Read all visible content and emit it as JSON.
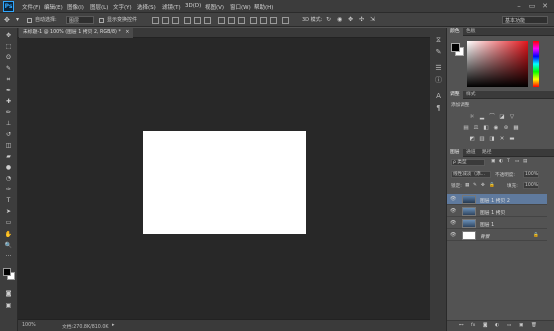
{
  "app": {
    "logo": "Ps"
  },
  "menubar": {
    "items": [
      "文件(F)",
      "编辑(E)",
      "图像(I)",
      "图层(L)",
      "文字(Y)",
      "选择(S)",
      "滤镜(T)",
      "3D(D)",
      "视图(V)",
      "窗口(W)",
      "帮助(H)"
    ],
    "window_controls": [
      "–",
      "▭",
      "✕"
    ]
  },
  "options": {
    "auto_select_label": "自动选择:",
    "auto_select_value": "图层",
    "show_transform_label": "显示变换控件",
    "mode_3d_label": "3D 模式:",
    "workspace_value": "基本功能"
  },
  "document": {
    "tab_title": "未标题-1 @ 100% (图层 1 拷贝 2, RGB/8) *",
    "tab_close": "×",
    "zoom": "100%",
    "doc_info": "文档:270.8K/810.0K"
  },
  "panels": {
    "color_tabs": [
      "颜色",
      "色板"
    ],
    "adjust_tabs": [
      "调整",
      "样式"
    ],
    "adjust_title": "添加调整",
    "layers_tabs": [
      "图层",
      "通道",
      "路径"
    ],
    "kind_label": "ρ 类型",
    "blend_mode": "线性减淡（添...",
    "opacity_label": "不透明度:",
    "opacity_value": "100%",
    "lock_label": "锁定:",
    "fill_label": "填充:",
    "fill_value": "100%",
    "layers": [
      {
        "name": "图层 1 拷贝 2",
        "selected": true
      },
      {
        "name": "图层 1 拷贝",
        "selected": false
      },
      {
        "name": "图层 1",
        "selected": false
      },
      {
        "name": "背景",
        "selected": false
      }
    ],
    "footer_icons": [
      "⊷",
      "fx",
      "◙",
      "◐",
      "▭",
      "▣",
      "🗑"
    ]
  },
  "colors": {
    "foreground": "#000000",
    "background": "#ffffff",
    "accent": "#31a8ff"
  }
}
